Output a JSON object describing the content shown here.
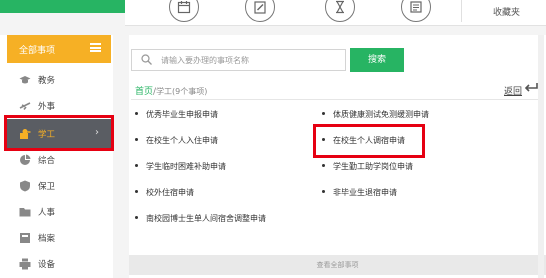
{
  "topbar": {
    "favorites_label": "收藏夹",
    "icons": [
      "calendar-icon",
      "edit-icon",
      "hourglass-icon",
      "schedule-icon"
    ]
  },
  "sidebar": {
    "header_label": "全部事项",
    "items": [
      {
        "label": "教务",
        "icon": "graduation-cap-icon"
      },
      {
        "label": "外事",
        "icon": "airplane-icon"
      },
      {
        "label": "学工",
        "icon": "student-icon",
        "active": true
      },
      {
        "label": "综合",
        "icon": "grid-icon"
      },
      {
        "label": "保卫",
        "icon": "shield-icon"
      },
      {
        "label": "人事",
        "icon": "folder-icon"
      },
      {
        "label": "档案",
        "icon": "archive-icon"
      },
      {
        "label": "设备",
        "icon": "printer-icon"
      }
    ]
  },
  "search": {
    "placeholder": "请输入要办理的事项名称",
    "button_label": "搜索"
  },
  "breadcrumb": {
    "home": "首页",
    "separator": "/",
    "current": "学工(9个事项)",
    "back_label": "返回"
  },
  "items": [
    "优秀毕业生申报申请",
    "体质健康测试免测缓测申请",
    "在校生个人入住申请",
    "在校生个人调宿申请",
    "学生临时困难补助申请",
    "学生勤工助学岗位申请",
    "校外住宿申请",
    "非毕业生退宿申请",
    "南校园博士生单人间宿舍调整申请"
  ],
  "bottom_button_label": "查看全部事项",
  "colors": {
    "accent_green": "#27b463",
    "header_orange": "#f6b025",
    "active_bg": "#5a5d63",
    "highlight_red": "#e60012"
  }
}
